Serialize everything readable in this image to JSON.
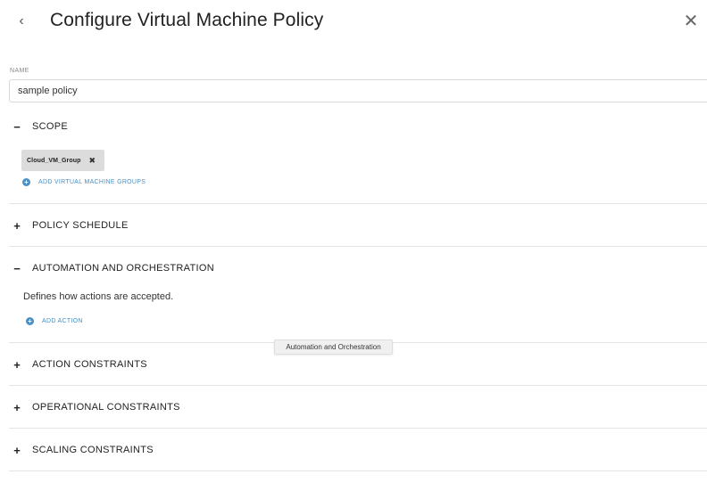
{
  "header": {
    "back_icon": "chevron-left-icon",
    "back_glyph": "‹",
    "title": "Configure Virtual Machine Policy",
    "close_icon": "close-icon",
    "close_glyph": "✕"
  },
  "name_field": {
    "label": "NAME",
    "value": "sample policy"
  },
  "sections": {
    "scope": {
      "toggle": "−",
      "title": "SCOPE",
      "chip_label": "Cloud_VM_Group",
      "chip_remove": "✖",
      "add_label": "ADD VIRTUAL MACHINE GROUPS"
    },
    "policy_schedule": {
      "toggle": "+",
      "title": "POLICY SCHEDULE"
    },
    "automation": {
      "toggle": "−",
      "title": "AUTOMATION AND ORCHESTRATION",
      "description": "Defines how actions are accepted.",
      "add_label": "ADD ACTION"
    },
    "action_constraints": {
      "toggle": "+",
      "title": "ACTION CONSTRAINTS"
    },
    "operational_constraints": {
      "toggle": "+",
      "title": "OPERATIONAL CONSTRAINTS"
    },
    "scaling_constraints": {
      "toggle": "+",
      "title": "SCALING CONSTRAINTS"
    }
  },
  "tooltip": "Automation and Orchestration",
  "colors": {
    "accent": "#4a90c4",
    "chip_bg": "#dcdcdc",
    "divider": "#e4e4e4"
  }
}
